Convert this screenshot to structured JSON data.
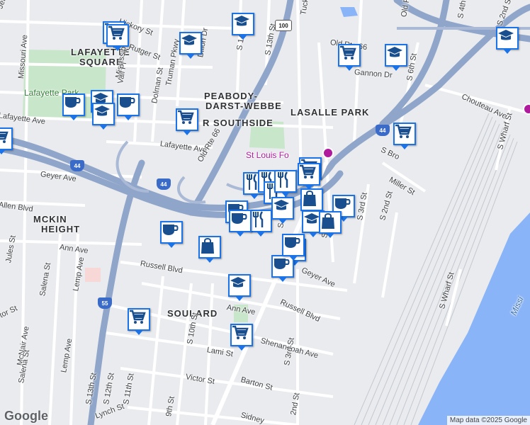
{
  "map": {
    "attribution": "Map data ©2025 Google",
    "logo_text": "Google",
    "colors": {
      "land": "#e9ebee",
      "water": "#8ab4f8",
      "park": "#c8e6c9",
      "highway": "#8fa5c9",
      "road": "#ffffff",
      "marker_border": "#1a73e8"
    }
  },
  "neighborhoods": [
    {
      "text": "LAFAYETTE"
    },
    {
      "text": "SQUARE"
    },
    {
      "text": "PEABODY-"
    },
    {
      "text": "DARST-WEBBE"
    },
    {
      "text": "LASALLE PARK"
    },
    {
      "text": "R SOUTHSIDE"
    },
    {
      "text": "MCKIN"
    },
    {
      "text": "HEIGHT"
    },
    {
      "text": "SOULARD"
    }
  ],
  "parks": [
    {
      "text": "Lafayette Park"
    }
  ],
  "water_labels": [
    {
      "text": "Missi"
    }
  ],
  "pois": [
    {
      "text": "St Louis Fo"
    }
  ],
  "streets": [
    "Jeff",
    "Hickory St",
    "Rutger St",
    "Missouri Ave",
    "Mississippi",
    "Dillon Dr",
    "Truman Pkwy",
    "Dolman St",
    "Vail Pl",
    "S 14th St",
    "S 13th St",
    "Tucker",
    "Old Rte 66",
    "Gannon Dr",
    "S 6th St",
    "Old Rte 66",
    "S 4th St",
    "S 2nd St",
    "Chouteau Ave",
    "Lafayette Ave",
    "Lafayette Ave",
    "Geyer Ave",
    "Old Rte 66",
    "S Bro",
    "Miller St",
    "S Wharf St",
    "Allen Blvd",
    "S 8th St",
    "S 7th",
    "S 3rd St",
    "S 2nd St",
    "Ann Ave",
    "Russell Blvd",
    "Geyer Ave",
    "Jules St",
    "Lemp Ave",
    "Salena St",
    "McNair Ave",
    "tor St",
    "Ann Ave",
    "Russell Blvd",
    "Shenandoah Ave",
    "S 10th St",
    "Lami St",
    "S 3rd St",
    "Victor St",
    "Barton St",
    "Salena St",
    "Lemp Ave",
    "S 13th St",
    "S 12th St",
    "S 11th St",
    "Lynch St",
    "9th St",
    "Sidney",
    "2nd St",
    "S Wharf St"
  ],
  "shields": [
    {
      "text": "100",
      "kind": "us"
    },
    {
      "text": "44",
      "kind": "i"
    },
    {
      "text": "44",
      "kind": "i"
    },
    {
      "text": "44",
      "kind": "i"
    },
    {
      "text": "55",
      "kind": "i"
    }
  ],
  "markers": [
    {
      "icon": "shopping-cart-icon"
    },
    {
      "icon": "shopping-cart-icon"
    },
    {
      "icon": "graduation-cap-icon"
    },
    {
      "icon": "graduation-cap-icon"
    },
    {
      "icon": "shopping-cart-icon"
    },
    {
      "icon": "graduation-cap-icon"
    },
    {
      "icon": "coffee-cup-icon"
    },
    {
      "icon": "graduation-cap-icon"
    },
    {
      "icon": "graduation-cap-icon"
    },
    {
      "icon": "coffee-cup-icon"
    },
    {
      "icon": "shopping-cart-icon"
    },
    {
      "icon": "shopping-cart-icon"
    },
    {
      "icon": "shopping-cart-icon"
    },
    {
      "icon": "graduation-cap-icon"
    },
    {
      "icon": "shopping-cart-icon"
    },
    {
      "icon": "fork-knife-icon"
    },
    {
      "icon": "fork-knife-icon"
    },
    {
      "icon": "fork-knife-icon"
    },
    {
      "icon": "shopping-cart-icon"
    },
    {
      "icon": "shopping-bag-icon"
    },
    {
      "icon": "fork-knife-icon"
    },
    {
      "icon": "coffee-cup-icon"
    },
    {
      "icon": "fork-knife-icon"
    },
    {
      "icon": "graduation-cap-icon"
    },
    {
      "icon": "graduation-cap-icon"
    },
    {
      "icon": "shopping-bag-icon"
    },
    {
      "icon": "coffee-cup-icon"
    },
    {
      "icon": "coffee-cup-icon"
    },
    {
      "icon": "coffee-cup-icon"
    },
    {
      "icon": "shopping-bag-icon"
    },
    {
      "icon": "graduation-cap-icon"
    },
    {
      "icon": "coffee-cup-icon"
    },
    {
      "icon": "graduation-cap-icon"
    },
    {
      "icon": "shopping-cart-icon"
    },
    {
      "icon": "shopping-cart-icon"
    },
    {
      "icon": "coffee-cup-icon"
    }
  ]
}
